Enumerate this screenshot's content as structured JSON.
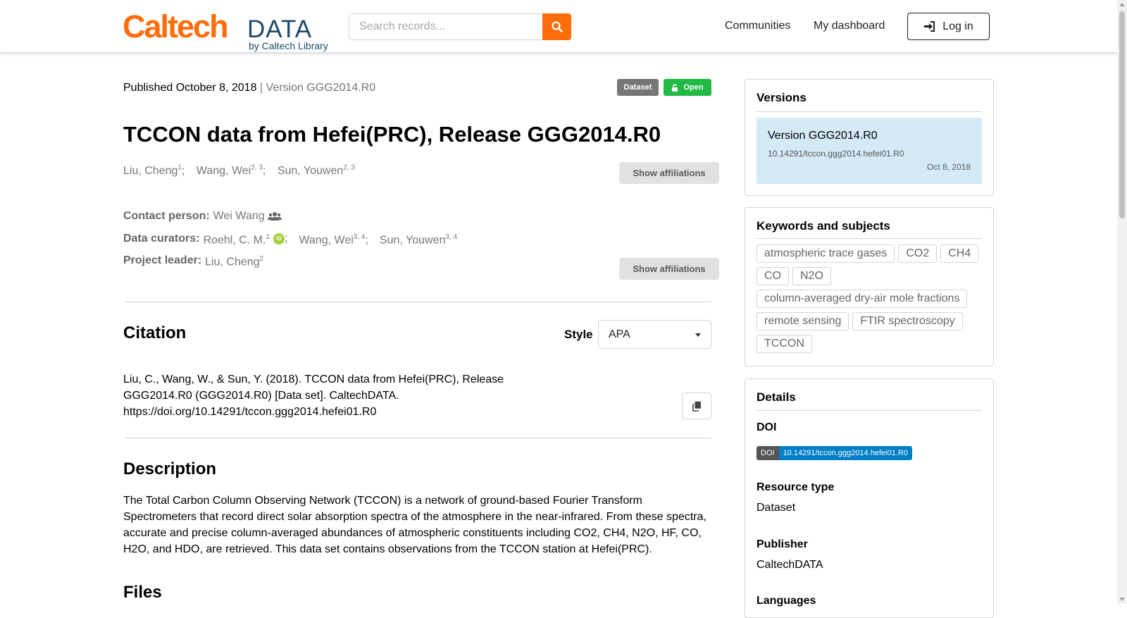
{
  "header": {
    "logo_caltech": "Caltech",
    "logo_data": "DATA",
    "logo_byline": "by Caltech Library",
    "search_placeholder": "Search records...",
    "nav": [
      "Communities",
      "My dashboard"
    ],
    "login_label": "Log in"
  },
  "record": {
    "published": "Published October 8, 2018",
    "version": "| Version GGG2014.R0",
    "badge_type": "Dataset",
    "badge_access": "Open",
    "title": "TCCON data from Hefei(PRC), Release GGG2014.R0",
    "authors": [
      {
        "name": "Liu, Cheng",
        "aff": "1"
      },
      {
        "name": "Wang, Wei",
        "aff": "2, 3"
      },
      {
        "name": "Sun, Youwen",
        "aff": "2, 3"
      }
    ],
    "show_affiliations": "Show affiliations",
    "contact_label": "Contact person:",
    "contact_name": "Wei Wang",
    "curators_label": "Data curators:",
    "curators": [
      {
        "name": "Roehl, C. M.",
        "aff": "1",
        "orcid": true
      },
      {
        "name": "Wang, Wei",
        "aff": "3, 4"
      },
      {
        "name": "Sun, Youwen",
        "aff": "3, 4"
      }
    ],
    "leader_label": "Project leader:",
    "leader_name": "Liu, Cheng",
    "leader_aff": "2"
  },
  "citation": {
    "heading": "Citation",
    "style_label": "Style",
    "style_value": "APA",
    "text": "Liu, C., Wang, W., & Sun, Y. (2018). TCCON data from Hefei(PRC), Release GGG2014.R0 (GGG2014.R0) [Data set]. CaltechDATA. https://doi.org/10.14291/tccon.ggg2014.hefei01.R0"
  },
  "description": {
    "heading": "Description",
    "text": "The Total Carbon Column Observing Network (TCCON) is a network of ground-based Fourier Transform Spectrometers that record direct solar absorption spectra of the atmosphere in the near-infrared. From these spectra, accurate and precise column-averaged abundances of atmospheric constituents including CO2, CH4, N2O, HF, CO, H2O, and HDO, are retrieved. This data set contains observations from the TCCON station at Hefei(PRC)."
  },
  "files": {
    "heading": "Files"
  },
  "sidebar": {
    "versions": {
      "heading": "Versions",
      "items": [
        {
          "label": "Version GGG2014.R0",
          "doi": "10.14291/tccon.ggg2014.hefei01.R0",
          "date": "Oct 8, 2018"
        }
      ]
    },
    "keywords": {
      "heading": "Keywords and subjects",
      "items": [
        "atmospheric trace gases",
        "CO2",
        "CH4",
        "CO",
        "N2O",
        "column-averaged dry-air mole fractions",
        "remote sensing",
        "FTIR spectroscopy",
        "TCCON"
      ]
    },
    "details": {
      "heading": "Details",
      "doi_label": "DOI",
      "doi_badge_left": "DOI",
      "doi_badge_value": "10.14291/tccon.ggg2014.hefei01.R0",
      "resource_type_label": "Resource type",
      "resource_type_value": "Dataset",
      "publisher_label": "Publisher",
      "publisher_value": "CaltechDATA",
      "languages_label": "Languages"
    }
  },
  "colors": {
    "brand_orange": "#ff6c0c",
    "badge_grey": "#767676",
    "badge_green": "#21ba45",
    "version_highlight": "#d4ebf7",
    "doi_blue": "#007ec6"
  },
  "icons": [
    "search-icon",
    "sign-in-icon",
    "unlock-icon",
    "users-icon",
    "orcid-icon",
    "copy-icon",
    "caret-down-icon"
  ]
}
